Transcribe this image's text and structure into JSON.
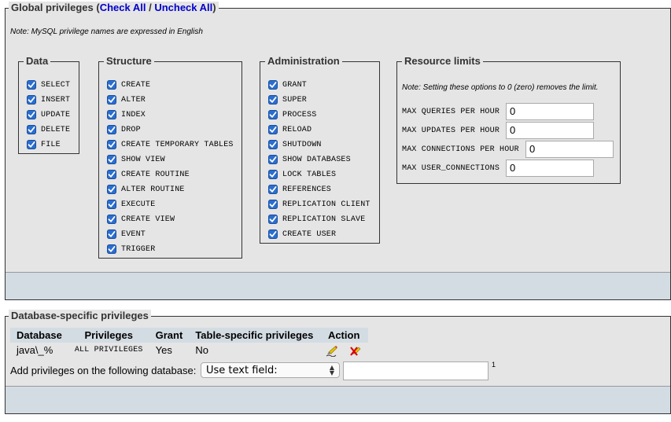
{
  "global": {
    "legend_prefix": "Global privileges (",
    "check_all": "Check All",
    "separator": " / ",
    "uncheck_all": "Uncheck All",
    "legend_suffix": ")",
    "note": "Note: MySQL privilege names are expressed in English"
  },
  "data_group": {
    "legend": "Data",
    "items": [
      "SELECT",
      "INSERT",
      "UPDATE",
      "DELETE",
      "FILE"
    ]
  },
  "structure_group": {
    "legend": "Structure",
    "items": [
      "CREATE",
      "ALTER",
      "INDEX",
      "DROP",
      "CREATE TEMPORARY TABLES",
      "SHOW VIEW",
      "CREATE ROUTINE",
      "ALTER ROUTINE",
      "EXECUTE",
      "CREATE VIEW",
      "EVENT",
      "TRIGGER"
    ]
  },
  "admin_group": {
    "legend": "Administration",
    "items": [
      "GRANT",
      "SUPER",
      "PROCESS",
      "RELOAD",
      "SHUTDOWN",
      "SHOW DATABASES",
      "LOCK TABLES",
      "REFERENCES",
      "REPLICATION CLIENT",
      "REPLICATION SLAVE",
      "CREATE USER"
    ]
  },
  "resource_limits": {
    "legend": "Resource limits",
    "note": "Note: Setting these options to 0 (zero) removes the limit.",
    "rows": [
      {
        "label": "MAX QUERIES PER HOUR",
        "value": "0"
      },
      {
        "label": "MAX UPDATES PER HOUR",
        "value": "0"
      },
      {
        "label": "MAX CONNECTIONS PER HOUR",
        "value": "0"
      },
      {
        "label": "MAX USER_CONNECTIONS",
        "value": "0"
      }
    ]
  },
  "db_specific": {
    "legend": "Database-specific privileges",
    "headers": [
      "Database",
      "Privileges",
      "Grant",
      "Table-specific privileges",
      "Action"
    ],
    "row": {
      "database": "java\\_%",
      "privileges": "ALL PRIVILEGES",
      "grant": "Yes",
      "table_specific": "No"
    },
    "add_label": "Add privileges on the following database:",
    "select_value": "Use text field:",
    "footnote": "1"
  },
  "icons": {
    "checkbox": "checkbox-checked-icon",
    "edit": "edit-privileges-icon",
    "revoke": "revoke-icon",
    "select_arrow": "select-arrows-icon"
  },
  "colors": {
    "checkbox": "#2a6ed0",
    "link": "#0000cc",
    "bar": "#d3dce3",
    "panel": "#e5e5e5"
  }
}
